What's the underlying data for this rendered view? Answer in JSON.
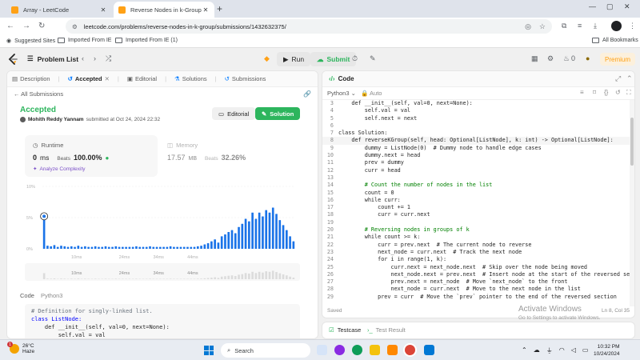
{
  "browser": {
    "tabs": [
      {
        "title": "Array - LeetCode",
        "active": false
      },
      {
        "title": "Reverse Nodes in k-Group - Le",
        "active": true
      }
    ],
    "url": "leetcode.com/problems/reverse-nodes-in-k-group/submissions/1432632375/",
    "bookmarks": [
      "Suggested Sites",
      "Imported From IE",
      "Imported From IE (1)"
    ],
    "all_bookmarks": "All Bookmarks"
  },
  "lc_nav": {
    "problem_list": "Problem List",
    "run": "Run",
    "submit": "Submit",
    "streak": "0",
    "premium": "Premium"
  },
  "left": {
    "tabs": [
      "Description",
      "Accepted",
      "Editorial",
      "Solutions",
      "Submissions"
    ],
    "all_submissions": "All Submissions",
    "status": "Accepted",
    "author": "Mohith Reddy Yannam",
    "submitted": "submitted at Oct 24, 2024 22:32",
    "editorial_btn": "Editorial",
    "solution_btn": "Solution",
    "runtime_label": "Runtime",
    "runtime_value": "0",
    "runtime_unit": "ms",
    "beats": "Beats",
    "runtime_beats": "100.00%",
    "analyze": "Analyze Complexity",
    "memory_label": "Memory",
    "memory_value": "17.57",
    "memory_unit": "MB",
    "memory_beats": "32.26%",
    "code_label": "Code",
    "lang": "Python3",
    "code_preview": [
      "# Definition for singly-linked list.",
      "class ListNode:",
      "    def __init__(self, val=0, next=None):",
      "        self.val = val"
    ]
  },
  "chart_data": {
    "type": "bar",
    "title": "",
    "ylabel": "",
    "y_ticks": [
      "10%",
      "5%",
      "0%"
    ],
    "x_ticks": [
      "10ms",
      "24ms",
      "34ms",
      "44ms"
    ],
    "ylim": [
      0,
      10
    ],
    "values": [
      4.7,
      0.5,
      0.4,
      0.6,
      0.3,
      0.5,
      0.4,
      0.3,
      0.4,
      0.3,
      0.5,
      0.3,
      0.4,
      0.3,
      0.3,
      0.4,
      0.3,
      0.3,
      0.4,
      0.3,
      0.3,
      0.4,
      0.3,
      0.3,
      0.3,
      0.3,
      0.3,
      0.4,
      0.3,
      0.3,
      0.3,
      0.4,
      0.3,
      0.3,
      0.3,
      0.3,
      0.3,
      0.4,
      0.3,
      0.3,
      0.3,
      0.3,
      0.3,
      0.3,
      0.3,
      0.4,
      0.5,
      0.7,
      0.9,
      1.2,
      1.5,
      1.0,
      2.0,
      2.3,
      2.7,
      3.0,
      2.5,
      3.5,
      4.0,
      4.8,
      4.4,
      5.8,
      4.8,
      5.8,
      5.2,
      6.2,
      5.8,
      6.6,
      5.6,
      4.6,
      3.8,
      3.0,
      2.0,
      1.2
    ],
    "highlight_index": 0,
    "grid": true
  },
  "right": {
    "title": "Code",
    "lang": "Python3",
    "auto": "Auto",
    "saved": "Saved",
    "cursor": "Ln 8, Col 35",
    "code_lines": [
      {
        "n": "3",
        "t": "    def __init__(self, val=0, next=None):"
      },
      {
        "n": "4",
        "t": "        self.val = val"
      },
      {
        "n": "5",
        "t": "        self.next = next"
      },
      {
        "n": "6",
        "t": ""
      },
      {
        "n": "7",
        "t": "class Solution:"
      },
      {
        "n": "8",
        "t": "    def reverseKGroup(self, head: Optional[ListNode], k: int) -> Optional[ListNode]:"
      },
      {
        "n": "9",
        "t": "        dummy = ListNode(0)  # Dummy node to handle edge cases"
      },
      {
        "n": "10",
        "t": "        dummy.next = head"
      },
      {
        "n": "11",
        "t": "        prev = dummy"
      },
      {
        "n": "12",
        "t": "        curr = head"
      },
      {
        "n": "13",
        "t": ""
      },
      {
        "n": "14",
        "t": "        # Count the number of nodes in the list"
      },
      {
        "n": "15",
        "t": "        count = 0"
      },
      {
        "n": "16",
        "t": "        while curr:"
      },
      {
        "n": "17",
        "t": "            count += 1"
      },
      {
        "n": "18",
        "t": "            curr = curr.next"
      },
      {
        "n": "19",
        "t": ""
      },
      {
        "n": "20",
        "t": "        # Reversing nodes in groups of k"
      },
      {
        "n": "21",
        "t": "        while count >= k:"
      },
      {
        "n": "22",
        "t": "            curr = prev.next  # The current node to reverse"
      },
      {
        "n": "23",
        "t": "            next_node = curr.next  # Track the next node"
      },
      {
        "n": "24",
        "t": "            for i in range(1, k):"
      },
      {
        "n": "25",
        "t": "                curr.next = next_node.next  # Skip over the node being moved"
      },
      {
        "n": "26",
        "t": "                next_node.next = prev.next  # Insert node at the start of the reversed section"
      },
      {
        "n": "27",
        "t": "                prev.next = next_node  # Move `next_node` to the front"
      },
      {
        "n": "28",
        "t": "                next_node = curr.next  # Move to the next node in the list"
      },
      {
        "n": "29",
        "t": "            prev = curr  # Move the `prev` pointer to the end of the reversed section"
      }
    ],
    "activate_title": "Activate Windows",
    "activate_sub": "Go to Settings to activate Windows."
  },
  "test": {
    "testcase": "Testcase",
    "result": "Test Result"
  },
  "taskbar": {
    "temp": "26°C",
    "weather": "Haze",
    "notif": "1",
    "search": "Search",
    "time": "10:32 PM",
    "date": "10/24/2024"
  },
  "colors": {
    "accent_green": "#2db55d",
    "brand_orange": "#ffa116",
    "bar_blue": "#1a73e8"
  }
}
